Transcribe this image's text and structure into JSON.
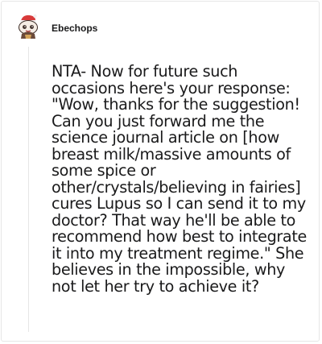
{
  "comment": {
    "username": "Ebechops",
    "avatar_icon": "snoo-avatar-icon",
    "body": "NTA- Now for future such occasions here's your response: \"Wow, thanks for the suggestion! Can you just forward me the science journal article on [how breast milk/massive amounts of some spice or other/crystals/believing in fairies] cures Lupus so I can send it to my doctor? That way he'll be able to recommend how best to integrate it into my treatment regime.\" She believes in the impossible, why not let her try to achieve it?"
  },
  "colors": {
    "text": "#1a1a1b",
    "border": "#e6e6e6",
    "background": "#ffffff"
  }
}
